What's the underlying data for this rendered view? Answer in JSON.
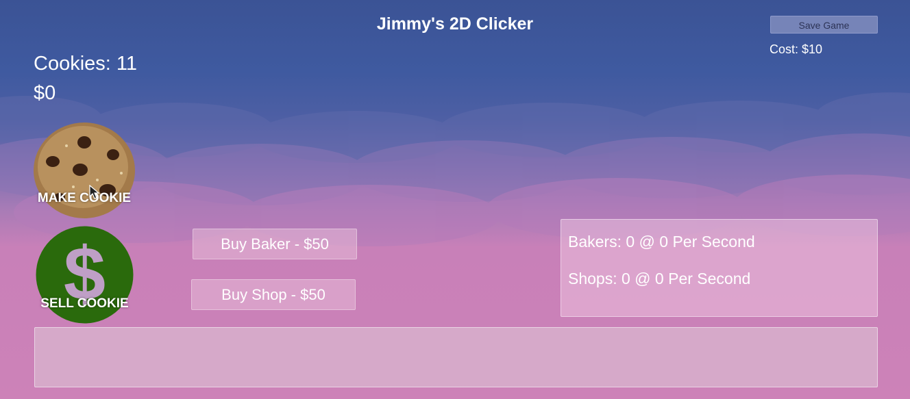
{
  "title": "Jimmy's 2D Clicker",
  "save_button": "Save Game",
  "cost": "Cost: $10",
  "cookies": "Cookies: 11",
  "money": "$0",
  "make_cookie_label": "MAKE COOKIE",
  "sell_cookie_label": "SELL COOKIE",
  "buy_baker": "Buy Baker - $50",
  "buy_shop": "Buy Shop - $50",
  "stats": {
    "bakers": "Bakers: 0 @ 0 Per Second",
    "shops": "Shops: 0 @ 0 Per Second"
  },
  "icons": {
    "cookie": "cookie-icon",
    "dollar": "dollar-coin-icon",
    "cursor": "mouse-pointer-icon"
  },
  "colors": {
    "sky_top": "#3b5395",
    "sky_bottom": "#cd82b8",
    "coin_green": "#2a6a0c"
  }
}
